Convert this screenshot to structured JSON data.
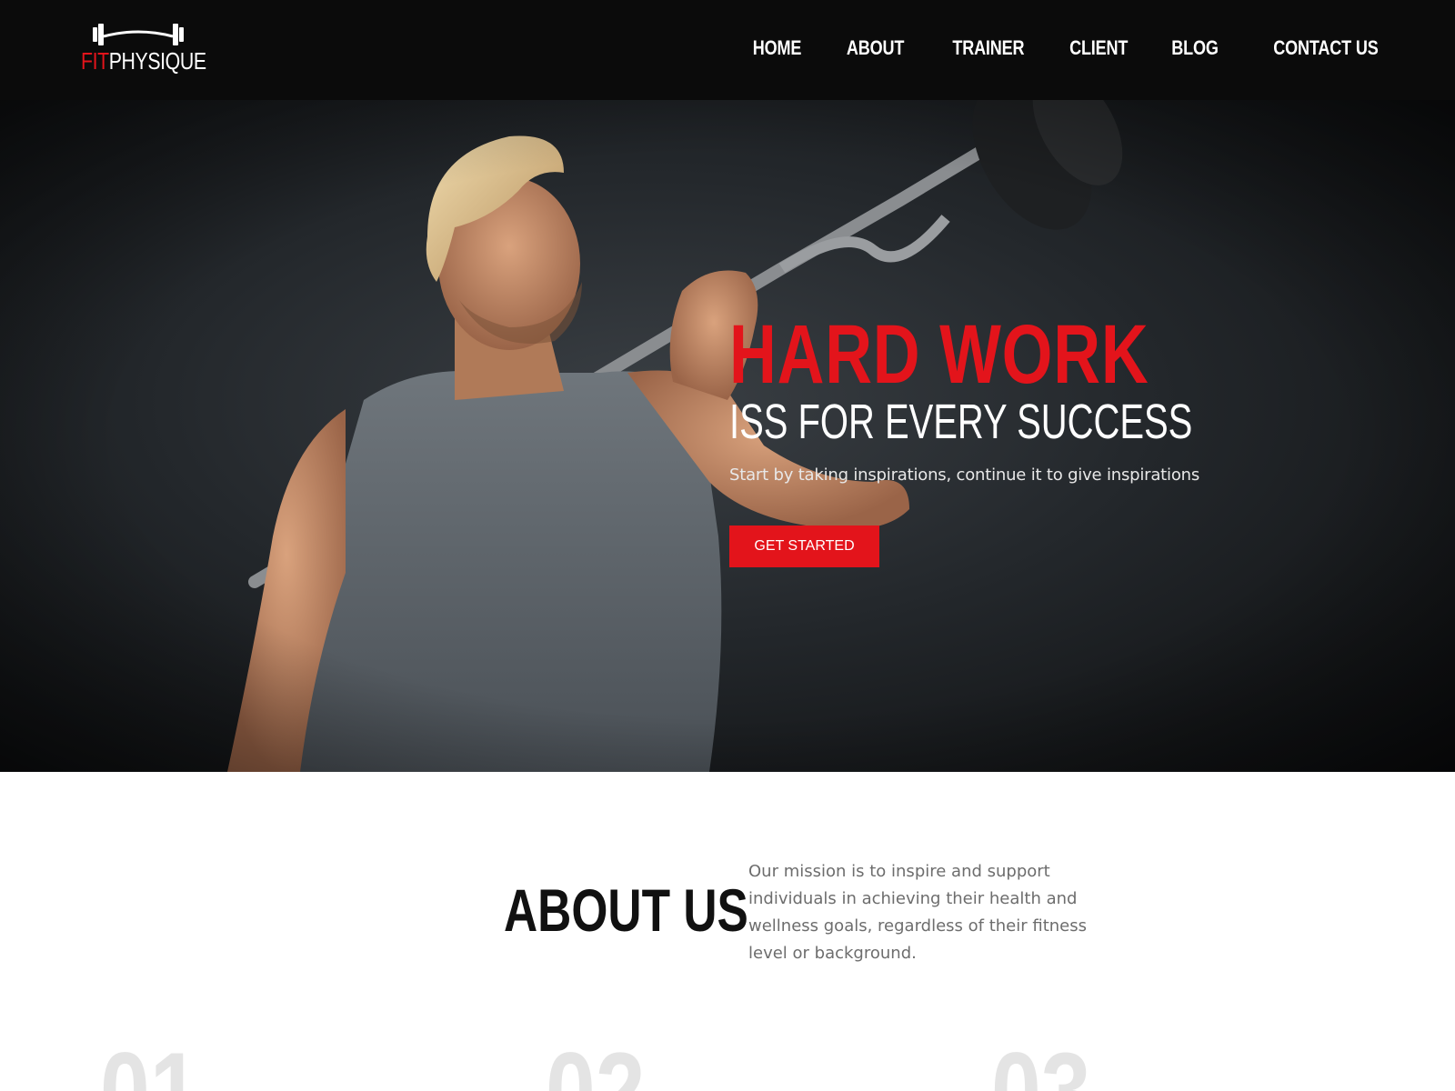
{
  "header": {
    "logo": {
      "fit": "FIT",
      "physique": "PHYSIQUE",
      "icon": "barbell-icon"
    },
    "nav": [
      {
        "label": "HOME"
      },
      {
        "label": "ABOUT"
      },
      {
        "label": "TRAINER"
      },
      {
        "label": "CLIENT"
      },
      {
        "label": "BLOG"
      },
      {
        "label": "CONTACT US"
      }
    ]
  },
  "hero": {
    "title_red": "HARD WORK",
    "title_white": "ISS FOR EVERY SUCCESS",
    "subtitle": "Start by taking inspirations, continue it to give inspirations",
    "cta_label": "GET STARTED",
    "image": "man-lifting-barbell-photo"
  },
  "about": {
    "title": "ABOUT US",
    "text": "Our mission is to inspire and support individuals in achieving their health and wellness goals, regardless of their fitness level or background.",
    "numbers": [
      "01",
      "02",
      "03"
    ]
  },
  "colors": {
    "accent": "#e3141b",
    "header_bg": "#0b0b0b",
    "number_gray": "#e4e4e4"
  }
}
